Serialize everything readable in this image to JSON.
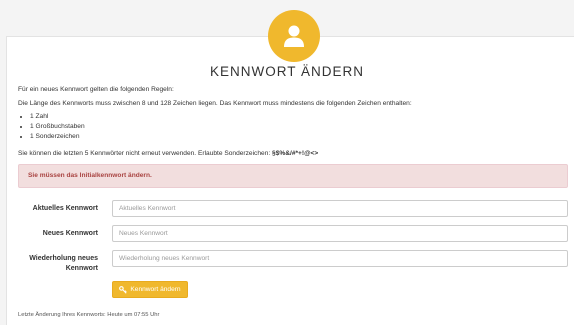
{
  "page": {
    "title": "KENNWORT ÄNDERN"
  },
  "rules": {
    "intro": "Für ein neues Kennwort gelten die folgenden Regeln:",
    "length": "Die Länge des Kennworts muss zwischen 8 und 128 Zeichen liegen. Das Kennwort muss mindestens die folgenden Zeichen enthalten:",
    "items": [
      "1 Zahl",
      "1 Großbuchstaben",
      "1 Sonderzeichen"
    ],
    "history": "Sie können die letzten 5 Kennwörter nicht erneut verwenden. Erlaubte Sonderzeichen: ",
    "special_chars": "§$%&/#*+!@<>"
  },
  "alert": {
    "text": "Sie müssen das Initialkennwort ändern."
  },
  "form": {
    "current": {
      "label": "Aktuelles Kennwort",
      "placeholder": "Aktuelles Kennwort",
      "value": ""
    },
    "new": {
      "label": "Neues Kennwort",
      "placeholder": "Neues Kennwort",
      "value": ""
    },
    "repeat": {
      "label": "Wiederholung neues Kennwort",
      "placeholder": "Wiederholung neues Kennwort",
      "value": ""
    },
    "submit_label": "Kennwort ändern"
  },
  "footer": {
    "last_change": "Letzte Änderung Ihres Kennworts: Heute um 07:55 Uhr"
  },
  "colors": {
    "accent": "#f0b82d",
    "alert_bg": "#f2dede",
    "alert_text": "#a94442"
  },
  "icons": {
    "avatar": "user-icon",
    "button": "key-icon"
  }
}
